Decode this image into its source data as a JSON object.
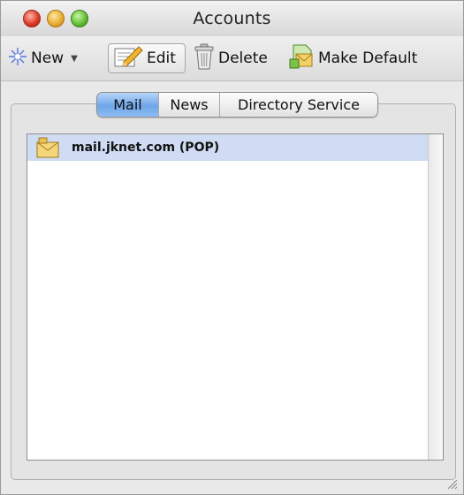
{
  "window": {
    "title": "Accounts"
  },
  "toolbar": {
    "new_label": "New",
    "edit_label": "Edit",
    "delete_label": "Delete",
    "make_default_label": "Make Default"
  },
  "tabs": [
    {
      "label": "Mail",
      "selected": true
    },
    {
      "label": "News",
      "selected": false
    },
    {
      "label": "Directory Service",
      "selected": false
    }
  ],
  "accounts": [
    {
      "label": "mail.jknet.com (POP)",
      "icon": "mail-account-icon",
      "selected": true
    }
  ],
  "colors": {
    "selection": "#cfdcf3",
    "active_tab": "#6ea6ea",
    "close": "#d9341f",
    "minimize": "#e8a92a",
    "zoom": "#5cbb2e"
  }
}
